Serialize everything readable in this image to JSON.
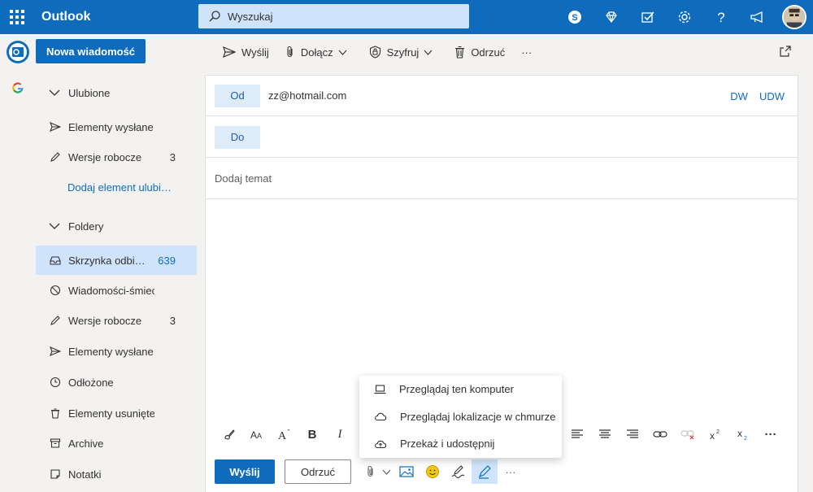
{
  "app": {
    "name": "Outlook",
    "brand_color": "#0f6cbd"
  },
  "search": {
    "placeholder": "Wyszukaj"
  },
  "top_icons": [
    "skype-icon",
    "diamond-icon",
    "todo-icon",
    "gear-icon",
    "help-icon",
    "megaphone-icon",
    "avatar"
  ],
  "left_rail": {
    "items": [
      "outlook-mail-icon",
      "google-icon"
    ]
  },
  "folders": {
    "new_message_label": "Nowa wiadomość",
    "favorites_header": "Ulubione",
    "favorites": [
      {
        "label": "Elementy wysłane",
        "count": "",
        "icon": "send-icon"
      },
      {
        "label": "Wersje robocze",
        "count": "3",
        "icon": "pencil-icon"
      }
    ],
    "add_favorite_label": "Dodaj element ulubi…",
    "folders_header": "Foldery",
    "items": [
      {
        "label": "Skrzynka odbi…",
        "count": "639",
        "icon": "inbox-icon",
        "selected": true
      },
      {
        "label": "Wiadomości-śmieci",
        "count": "",
        "icon": "block-icon"
      },
      {
        "label": "Wersje robocze",
        "count": "3",
        "icon": "pencil-icon"
      },
      {
        "label": "Elementy wysłane",
        "count": "",
        "icon": "send-icon"
      },
      {
        "label": "Odłożone",
        "count": "",
        "icon": "clock-icon"
      },
      {
        "label": "Elementy usunięte",
        "count": "",
        "icon": "trash-icon"
      },
      {
        "label": "Archive",
        "count": "",
        "icon": "archive-icon"
      },
      {
        "label": "Notatki",
        "count": "",
        "icon": "note-icon"
      }
    ]
  },
  "commandbar": {
    "send": "Wyślij",
    "attach": "Dołącz",
    "encrypt": "Szyfruj",
    "discard": "Odrzuć",
    "more": "···"
  },
  "compose": {
    "from_label": "Od",
    "from_value": "zz@hotmail.com",
    "cc": "DW",
    "bcc": "UDW",
    "to_label": "Do",
    "subject_placeholder": "Dodaj temat",
    "send_button": "Wyślij",
    "discard_button": "Odrzuć",
    "more": "···"
  },
  "attach_menu": {
    "items": [
      {
        "label": "Przeglądaj ten komputer",
        "icon": "laptop-icon"
      },
      {
        "label": "Przeglądaj lokalizacje w chmurze",
        "icon": "cloud-icon"
      },
      {
        "label": "Przekaż i udostępnij",
        "icon": "cloud-upload-icon"
      }
    ]
  }
}
